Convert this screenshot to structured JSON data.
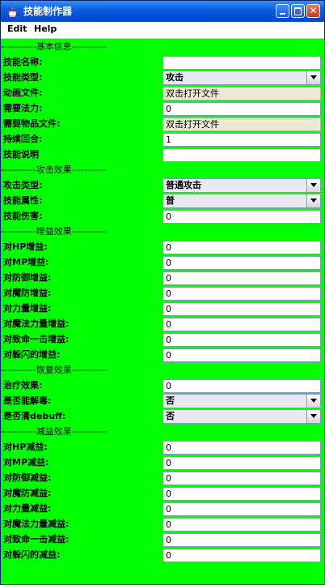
{
  "window": {
    "title": "技能制作器"
  },
  "menu": [
    "Edit",
    "Help"
  ],
  "sections": {
    "basic": "-----------基本信息-----------",
    "attack": "-----------攻击效果-----------",
    "buff": "-----------增益效果-----------",
    "recovery": "-----------恢复效果-----------",
    "debuff": "-----------减益效果-----------"
  },
  "basic": {
    "name_label": "技能名称:",
    "name_value": "",
    "type_label": "技能类型:",
    "type_value": "攻击",
    "anim_label": "动画文件:",
    "anim_value": "双击打开文件",
    "mana_label": "需要法力:",
    "mana_value": "0",
    "item_label": "需要物品文件:",
    "item_value": "双击打开文件",
    "duration_label": "持续回合:",
    "duration_value": "1",
    "desc_label": "技能说明",
    "desc_value": ""
  },
  "attack": {
    "type_label": "攻击类型:",
    "type_value": "普通攻击",
    "attr_label": "技能属性:",
    "attr_value": "普",
    "damage_label": "技能伤害:",
    "damage_value": "0"
  },
  "buff": [
    {
      "label": "对HP增益:",
      "value": "0"
    },
    {
      "label": "对MP增益:",
      "value": "0"
    },
    {
      "label": "对防御增益:",
      "value": "0"
    },
    {
      "label": "对魔防增益:",
      "value": "0"
    },
    {
      "label": "对力量增益:",
      "value": "0"
    },
    {
      "label": "对魔法力量增益:",
      "value": "0"
    },
    {
      "label": "对致命一击增益:",
      "value": "0"
    },
    {
      "label": "对躲闪的增益:",
      "value": "0"
    }
  ],
  "recovery": {
    "heal_label": "治疗效果:",
    "heal_value": "0",
    "detox_label": "是否能解毒:",
    "detox_value": "否",
    "cleanse_label": "是否清debuff:",
    "cleanse_value": "否"
  },
  "debuff": [
    {
      "label": "对HP减益:",
      "value": "0"
    },
    {
      "label": "对MP减益:",
      "value": "0"
    },
    {
      "label": "对防御减益:",
      "value": "0"
    },
    {
      "label": "对魔防减益:",
      "value": "0"
    },
    {
      "label": "对力量减益:",
      "value": "0"
    },
    {
      "label": "对魔法力量减益:",
      "value": "0"
    },
    {
      "label": "对致命一击减益:",
      "value": "0"
    },
    {
      "label": "对躲闪的减益:",
      "value": "0"
    }
  ]
}
